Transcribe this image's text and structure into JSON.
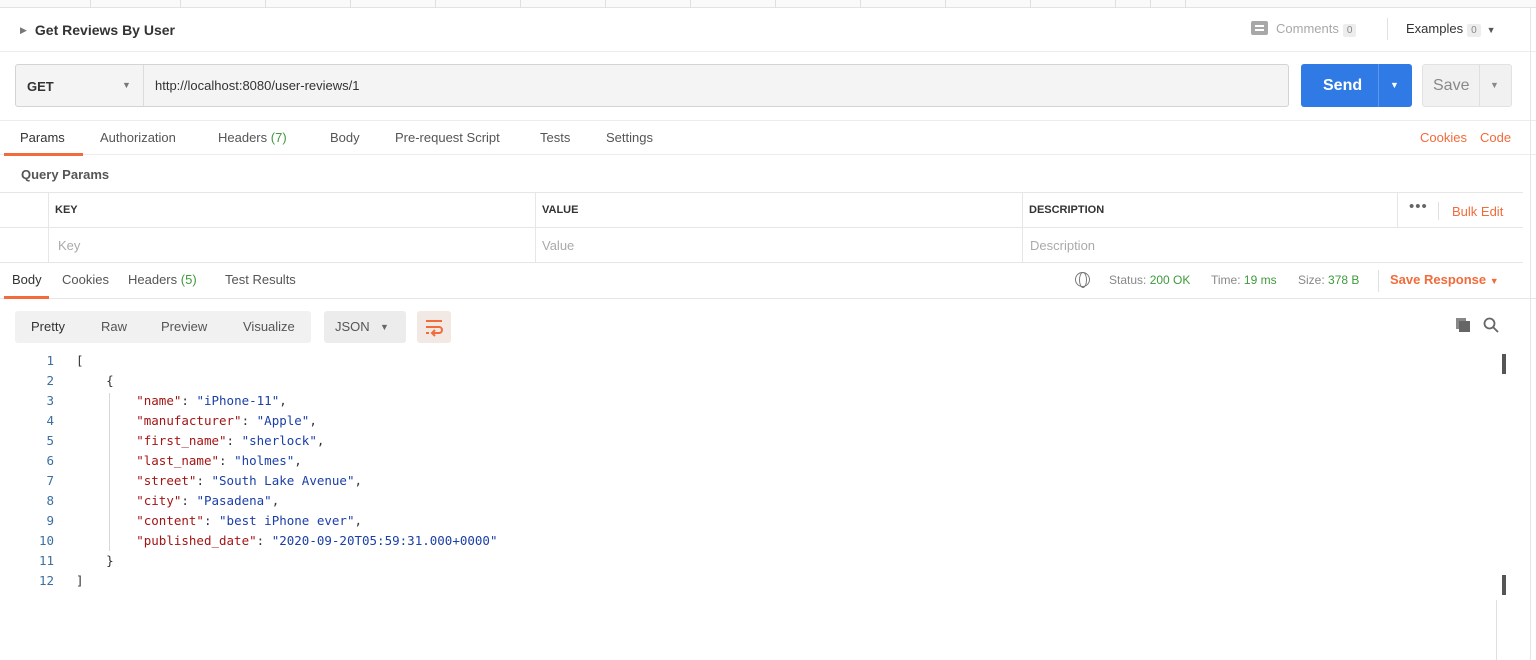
{
  "request": {
    "title": "Get Reviews By User",
    "comments_label": "Comments",
    "comments_count": "0",
    "examples_label": "Examples",
    "examples_count": "0",
    "method": "GET",
    "url": "http://localhost:8080/user-reviews/1",
    "send_label": "Send",
    "save_label": "Save"
  },
  "request_tabs": {
    "params": "Params",
    "authorization": "Authorization",
    "headers": "Headers",
    "headers_count": "(7)",
    "body": "Body",
    "prerequest": "Pre-request Script",
    "tests": "Tests",
    "settings": "Settings",
    "cookies": "Cookies",
    "code": "Code"
  },
  "query_params": {
    "title": "Query Params",
    "headers": {
      "key": "KEY",
      "value": "VALUE",
      "description": "DESCRIPTION"
    },
    "placeholders": {
      "key": "Key",
      "value": "Value",
      "description": "Description"
    },
    "more": "•••",
    "bulk_edit": "Bulk Edit"
  },
  "response_tabs": {
    "body": "Body",
    "cookies": "Cookies",
    "headers": "Headers",
    "headers_count": "(5)",
    "test_results": "Test Results"
  },
  "response_status": {
    "status_label": "Status:",
    "status_value": "200 OK",
    "time_label": "Time:",
    "time_value": "19 ms",
    "size_label": "Size:",
    "size_value": "378 B",
    "save_response": "Save Response"
  },
  "formats": {
    "pretty": "Pretty",
    "raw": "Raw",
    "preview": "Preview",
    "visualize": "Visualize",
    "language": "JSON"
  },
  "colors": {
    "accent": "#f26b3a",
    "send": "#2f7ae5",
    "success": "#3e9b3e",
    "json_key": "#a31515",
    "json_string": "#1a3fa8"
  },
  "code_lines": [
    {
      "n": "1",
      "pre": "[",
      "key": "",
      "mid": "",
      "val": "",
      "post": ""
    },
    {
      "n": "2",
      "pre": "    {",
      "key": "",
      "mid": "",
      "val": "",
      "post": ""
    },
    {
      "n": "3",
      "pre": "        ",
      "key": "\"name\"",
      "mid": ": ",
      "val": "\"iPhone-11\"",
      "post": ","
    },
    {
      "n": "4",
      "pre": "        ",
      "key": "\"manufacturer\"",
      "mid": ": ",
      "val": "\"Apple\"",
      "post": ","
    },
    {
      "n": "5",
      "pre": "        ",
      "key": "\"first_name\"",
      "mid": ": ",
      "val": "\"sherlock\"",
      "post": ","
    },
    {
      "n": "6",
      "pre": "        ",
      "key": "\"last_name\"",
      "mid": ": ",
      "val": "\"holmes\"",
      "post": ","
    },
    {
      "n": "7",
      "pre": "        ",
      "key": "\"street\"",
      "mid": ": ",
      "val": "\"South Lake Avenue\"",
      "post": ","
    },
    {
      "n": "8",
      "pre": "        ",
      "key": "\"city\"",
      "mid": ": ",
      "val": "\"Pasadena\"",
      "post": ","
    },
    {
      "n": "9",
      "pre": "        ",
      "key": "\"content\"",
      "mid": ": ",
      "val": "\"best iPhone ever\"",
      "post": ","
    },
    {
      "n": "10",
      "pre": "        ",
      "key": "\"published_date\"",
      "mid": ": ",
      "val": "\"2020-09-20T05:59:31.000+0000\"",
      "post": ""
    },
    {
      "n": "11",
      "pre": "    }",
      "key": "",
      "mid": "",
      "val": "",
      "post": ""
    },
    {
      "n": "12",
      "pre": "]",
      "key": "",
      "mid": "",
      "val": "",
      "post": ""
    }
  ]
}
